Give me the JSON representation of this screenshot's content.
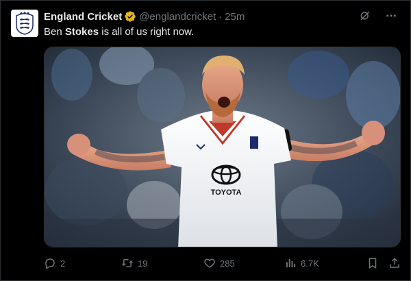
{
  "author": {
    "name": "England Cricket",
    "handle": "@englandcricket",
    "separator": "·",
    "time": "25m"
  },
  "tweet": {
    "text_pre": "Ben ",
    "text_bold": "Stokes",
    "text_post": " is all of us right now."
  },
  "media": {
    "shirt_sponsor": "TOYOTA"
  },
  "stats": {
    "replies": "2",
    "retweets": "19",
    "likes": "285",
    "views": "6.7K"
  },
  "icons": {
    "verified": "verified-gold-badge-icon",
    "grok": "grok-icon",
    "more": "more-icon",
    "reply": "reply-icon",
    "retweet": "retweet-icon",
    "like": "heart-icon",
    "views": "views-icon",
    "bookmark": "bookmark-icon",
    "share": "share-icon"
  },
  "colors": {
    "background": "#000000",
    "text": "#e7e9ea",
    "muted": "#71767b",
    "verified": "#e2b719"
  }
}
